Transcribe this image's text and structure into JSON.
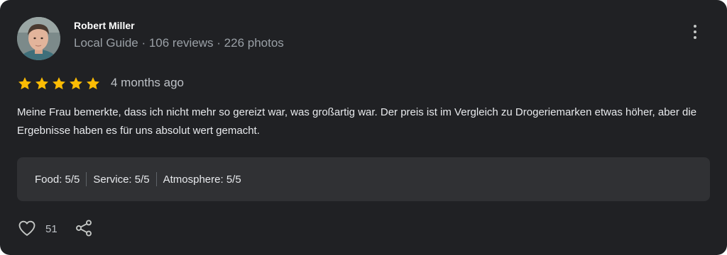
{
  "review": {
    "author": "Robert Miller",
    "meta": "Local Guide · 106 reviews · 226 photos",
    "rating_stars": 5,
    "time": "4 months ago",
    "text": "Meine Frau bemerkte, dass ich nicht mehr so gereizt war, was großartig war. Der preis ist im Vergleich zu Drogeriemarken etwas höher, aber die Ergebnisse haben es für uns absolut wert gemacht.",
    "sub_ratings": [
      "Food: 5/5",
      "Service: 5/5",
      "Atmosphere: 5/5"
    ],
    "likes": "51"
  },
  "icons": {
    "more": "more-vert-icon",
    "star": "star-icon",
    "like": "heart-icon",
    "share": "share-icon"
  },
  "colors": {
    "card_bg": "#202124",
    "star": "#fbbc04",
    "panel_bg": "#303134"
  }
}
